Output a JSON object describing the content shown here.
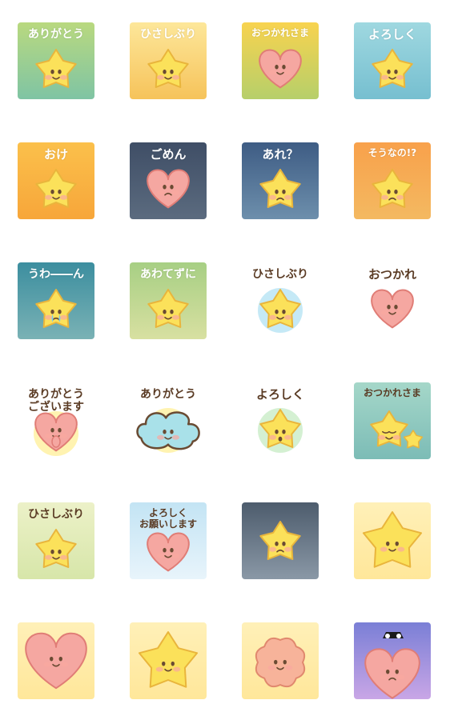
{
  "stickers": [
    {
      "caption": "ありがとう",
      "char": "star",
      "face": "smile",
      "bg": [
        "#b9d97f",
        "#7fc4a4"
      ],
      "style": "onbg"
    },
    {
      "caption": "ひさしぶり",
      "char": "star",
      "face": "smile",
      "bg": [
        "#fde79a",
        "#f6c35a"
      ],
      "style": "onbg"
    },
    {
      "caption": "おつかれさま",
      "char": "heart",
      "face": "smile",
      "bg": [
        "#f8d34f",
        "#b6cf6a"
      ],
      "style": "onbg"
    },
    {
      "caption": "よろしく",
      "char": "star",
      "face": "smile",
      "bg": [
        "#9fd8e0",
        "#76bfd0"
      ],
      "style": "onbg"
    },
    {
      "caption": "おけ",
      "char": "star",
      "face": "smile",
      "bg": [
        "#fbc04b",
        "#f7a63a"
      ],
      "style": "onbg"
    },
    {
      "caption": "ごめん",
      "char": "heart",
      "face": "sad",
      "bg": [
        "#3f4e66",
        "#5b6b7f"
      ],
      "style": "onbg"
    },
    {
      "caption": "あれ？",
      "char": "star",
      "face": "sad",
      "bg": [
        "#3e5c84",
        "#6d8fac"
      ],
      "style": "onbg"
    },
    {
      "caption": "そうなの!?",
      "char": "star",
      "face": "sad",
      "bg": [
        "#f8a14b",
        "#f4b961"
      ],
      "style": "onbg"
    },
    {
      "caption": "うわ――ん",
      "char": "star",
      "face": "cry",
      "bg": [
        "#3c8e9f",
        "#7ab2b5"
      ],
      "style": "onbg"
    },
    {
      "caption": "あわてずに",
      "char": "star",
      "face": "smile",
      "bg": [
        "#a7cf84",
        "#d8e0a1"
      ],
      "style": "onbg"
    },
    {
      "caption": "ひさしぶり",
      "char": "star",
      "face": "smile",
      "bg": [
        "#ffffff",
        "#ffffff"
      ],
      "style": "dark",
      "blob": "#bfe7f5"
    },
    {
      "caption": "おつかれ",
      "char": "heart",
      "face": "smile",
      "bg": [
        "#ffffff",
        "#ffffff"
      ],
      "style": "dark",
      "blob": "#ffffff"
    },
    {
      "caption": "ありがとう\nございます",
      "char": "heart",
      "face": "pray",
      "bg": [
        "#ffffff",
        "#ffffff"
      ],
      "style": "dark",
      "blob": "#fff2a8"
    },
    {
      "caption": "ありがとう",
      "char": "cloud",
      "face": "smile",
      "bg": [
        "#ffffff",
        "#ffffff"
      ],
      "style": "dark",
      "blob": "#fff2a8"
    },
    {
      "caption": "よろしく",
      "char": "star",
      "face": "wow",
      "bg": [
        "#ffffff",
        "#ffffff"
      ],
      "style": "dark",
      "blob": "#cfeecd"
    },
    {
      "caption": "おつかれさま",
      "char": "twostars",
      "face": "sleep",
      "bg": [
        "#a5d7c9",
        "#7cbcb6"
      ],
      "style": "dark"
    },
    {
      "caption": "ひさしぶり",
      "char": "star",
      "face": "smile",
      "bg": [
        "#ecf1c8",
        "#d7e6a9"
      ],
      "style": "dark"
    },
    {
      "caption": "よろしく\nお願いします",
      "char": "heart",
      "face": "smile",
      "bg": [
        "#c3e4f4",
        "#e8f4fb"
      ],
      "style": "dark"
    },
    {
      "caption": "",
      "char": "star",
      "face": "worried",
      "bg": [
        "#4d5c6d",
        "#8a98a6"
      ],
      "style": "onbg"
    },
    {
      "caption": "",
      "char": "bigstar",
      "face": "smile",
      "bg": [
        "#fff0b8",
        "#ffe79a"
      ],
      "style": "onbg"
    },
    {
      "caption": "",
      "char": "bigheart",
      "face": "smile",
      "bg": [
        "#fff0b8",
        "#ffe79a"
      ],
      "style": "onbg"
    },
    {
      "caption": "",
      "char": "bigstar",
      "face": "smile",
      "bg": [
        "#fff0b8",
        "#ffe79a"
      ],
      "style": "onbg"
    },
    {
      "caption": "",
      "char": "bigcloud",
      "face": "smile",
      "bg": [
        "#fff0b8",
        "#ffe79a"
      ],
      "style": "onbg"
    },
    {
      "caption": "",
      "char": "angryheart",
      "face": "frown",
      "bg": [
        "#7a7fd6",
        "#c9a6e6"
      ],
      "style": "onbg"
    }
  ],
  "colors": {
    "star": "#fbe15a",
    "starStroke": "#e9b53c",
    "heart": "#f5a7a1",
    "heartStroke": "#e07d76",
    "cloud": "#a9e1e9",
    "cloudStroke": "#6a4b33",
    "outline": "#6a4b33",
    "cheek": "#f9a8a0"
  }
}
